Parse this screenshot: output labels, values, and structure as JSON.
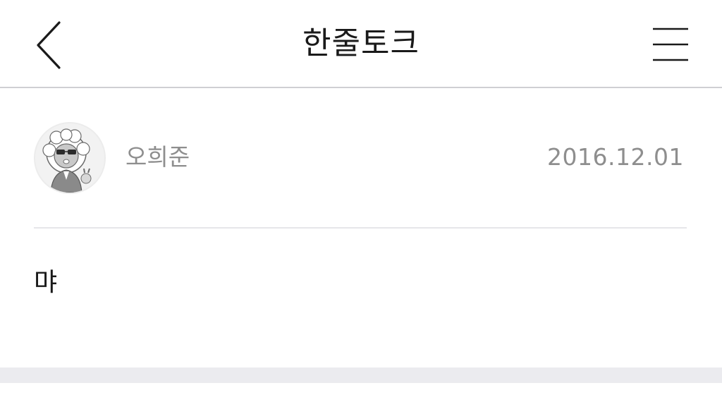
{
  "header": {
    "title": "한줄토크",
    "back_icon": "chevron-left-icon",
    "menu_icon": "hamburger-menu-icon"
  },
  "post": {
    "author": {
      "name": "오희준",
      "avatar_icon": "character-avatar"
    },
    "date": "2016.12.01",
    "body": "먀"
  },
  "colors": {
    "title_text": "#1a1a1a",
    "meta_text": "#8e8e8e",
    "divider": "#e6e6e9",
    "footer_band": "#ebebef"
  }
}
